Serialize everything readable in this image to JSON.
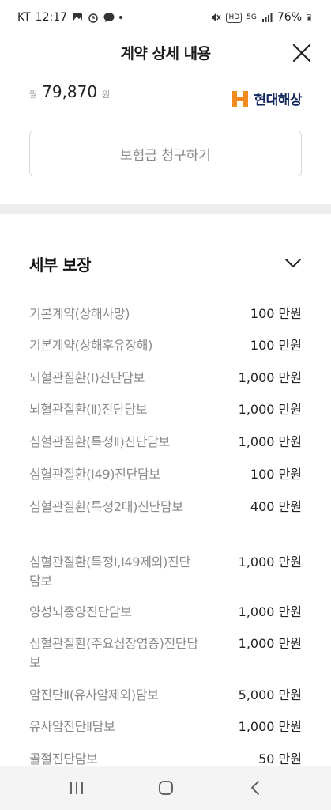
{
  "status_bar": {
    "carrier": "KT",
    "time": "12:17",
    "signal_label": "5G",
    "battery": "76%"
  },
  "header": {
    "title": "계약 상세 내용"
  },
  "summary": {
    "currency_prefix": "월",
    "premium": "79,870",
    "currency_suffix": "원",
    "insurer": "현대해상",
    "claim_button_label": "보험금 청구하기"
  },
  "details": {
    "title": "세부 보장",
    "coverages": [
      {
        "name": "기본계약(상해사망)",
        "amount": "100 만원"
      },
      {
        "name": "기본계약(상해후유장해)",
        "amount": "100 만원"
      },
      {
        "name": "뇌혈관질환(Ⅰ)진단담보",
        "amount": "1,000 만원"
      },
      {
        "name": "뇌혈관질환(Ⅱ)진단담보",
        "amount": "1,000 만원"
      },
      {
        "name": "심혈관질환(특정Ⅱ)진단담보",
        "amount": "1,000 만원"
      },
      {
        "name": "심혈관질환(I49)진단담보",
        "amount": "100 만원"
      },
      {
        "name": "심혈관질환(특정2대)진단담보",
        "amount": "400 만원"
      },
      {
        "name": "심혈관질환(특정Ⅰ,I49제외)진단담보",
        "amount": "1,000 만원"
      },
      {
        "name": "양성뇌종양진단담보",
        "amount": "1,000 만원"
      },
      {
        "name": "심혈관질환(주요심장염증)진단담보",
        "amount": "1,000 만원"
      },
      {
        "name": "암진단Ⅱ(유사암제외)담보",
        "amount": "5,000 만원"
      },
      {
        "name": "유사암진단Ⅱ담보",
        "amount": "1,000 만원"
      },
      {
        "name": "골절진단담보",
        "amount": "50 만원"
      }
    ]
  },
  "colors": {
    "brand_orange": "#f08b1f",
    "brand_navy": "#11275b",
    "muted_text": "#8a8a8a"
  }
}
